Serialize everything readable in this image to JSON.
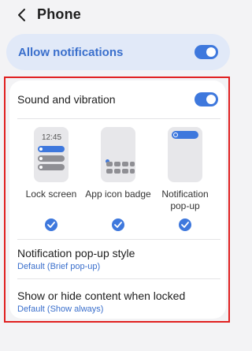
{
  "header": {
    "title": "Phone"
  },
  "allow_notifications": {
    "label": "Allow notifications",
    "enabled": true
  },
  "sound_vibration": {
    "label": "Sound and vibration",
    "enabled": true
  },
  "notification_types": [
    {
      "label": "Lock screen",
      "preview_time": "12:45",
      "checked": true
    },
    {
      "label": "App icon badge",
      "checked": true
    },
    {
      "label": "Notification pop-up",
      "checked": true
    }
  ],
  "settings": [
    {
      "title": "Notification pop-up style",
      "value": "Default (Brief pop-up)"
    },
    {
      "title": "Show or hide content when locked",
      "value": "Default (Show always)"
    }
  ],
  "colors": {
    "accent": "#3e78dd",
    "highlight_border": "#e02020",
    "background": "#f3f3f5"
  },
  "icons": {
    "back": "chevron-left-icon",
    "check": "check-icon"
  }
}
